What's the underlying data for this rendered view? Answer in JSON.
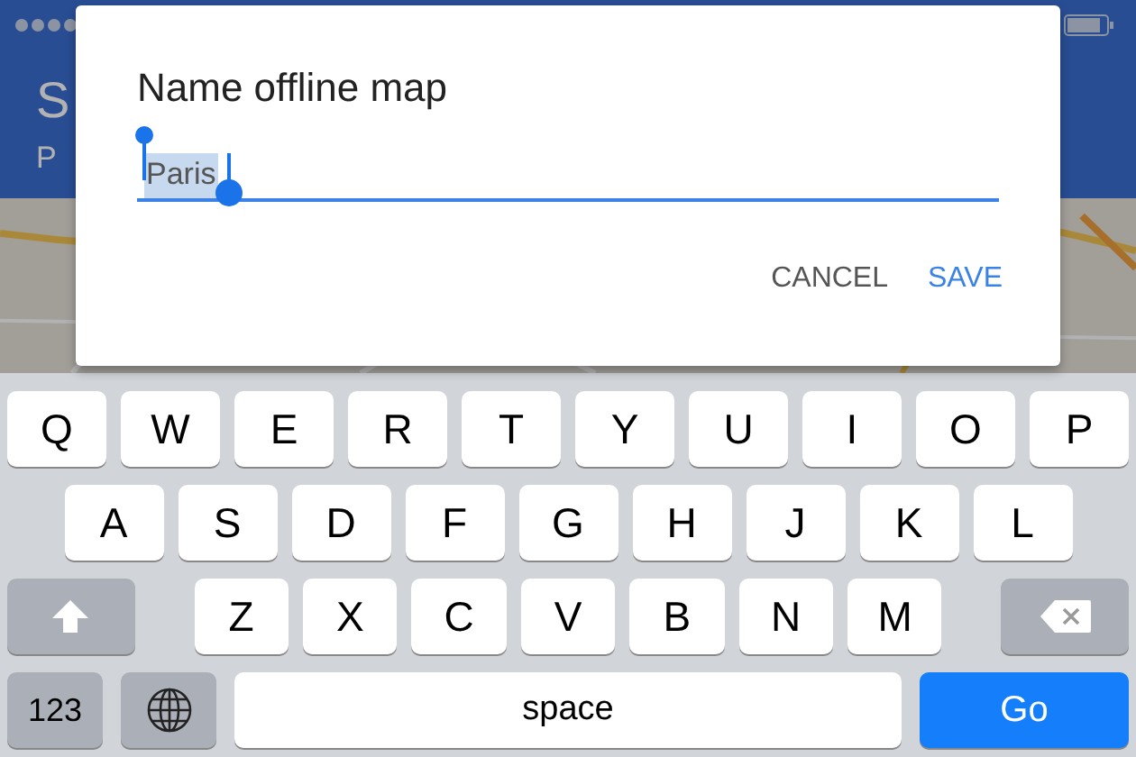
{
  "app_header": {
    "title": "S",
    "subtitle": "P"
  },
  "dialog": {
    "title": "Name offline map",
    "field": {
      "value": "Paris",
      "text_selected": true
    },
    "buttons": [
      {
        "label": "CANCEL",
        "kind": "secondary"
      },
      {
        "label": "SAVE",
        "kind": "primary"
      }
    ]
  },
  "keyboard": {
    "rows": [
      {
        "keys": [
          {
            "label": "Q",
            "kind": "letter"
          },
          {
            "label": "W",
            "kind": "letter"
          },
          {
            "label": "E",
            "kind": "letter"
          },
          {
            "label": "R",
            "kind": "letter"
          },
          {
            "label": "T",
            "kind": "letter"
          },
          {
            "label": "Y",
            "kind": "letter"
          },
          {
            "label": "U",
            "kind": "letter"
          },
          {
            "label": "I",
            "kind": "letter"
          },
          {
            "label": "O",
            "kind": "letter"
          },
          {
            "label": "P",
            "kind": "letter"
          }
        ]
      },
      {
        "keys": [
          {
            "label": "A",
            "kind": "letter"
          },
          {
            "label": "S",
            "kind": "letter"
          },
          {
            "label": "D",
            "kind": "letter"
          },
          {
            "label": "F",
            "kind": "letter"
          },
          {
            "label": "G",
            "kind": "letter"
          },
          {
            "label": "H",
            "kind": "letter"
          },
          {
            "label": "J",
            "kind": "letter"
          },
          {
            "label": "K",
            "kind": "letter"
          },
          {
            "label": "L",
            "kind": "letter"
          }
        ]
      },
      {
        "keys": [
          {
            "kind": "shift"
          },
          {
            "label": "Z",
            "kind": "letter"
          },
          {
            "label": "X",
            "kind": "letter"
          },
          {
            "label": "C",
            "kind": "letter"
          },
          {
            "label": "V",
            "kind": "letter"
          },
          {
            "label": "B",
            "kind": "letter"
          },
          {
            "label": "N",
            "kind": "letter"
          },
          {
            "label": "M",
            "kind": "letter"
          },
          {
            "kind": "delete"
          }
        ]
      },
      {
        "keys": [
          {
            "label": "123",
            "kind": "mode"
          },
          {
            "kind": "globe"
          },
          {
            "label": "space",
            "kind": "space"
          },
          {
            "label": "Go",
            "kind": "go"
          }
        ]
      }
    ]
  }
}
